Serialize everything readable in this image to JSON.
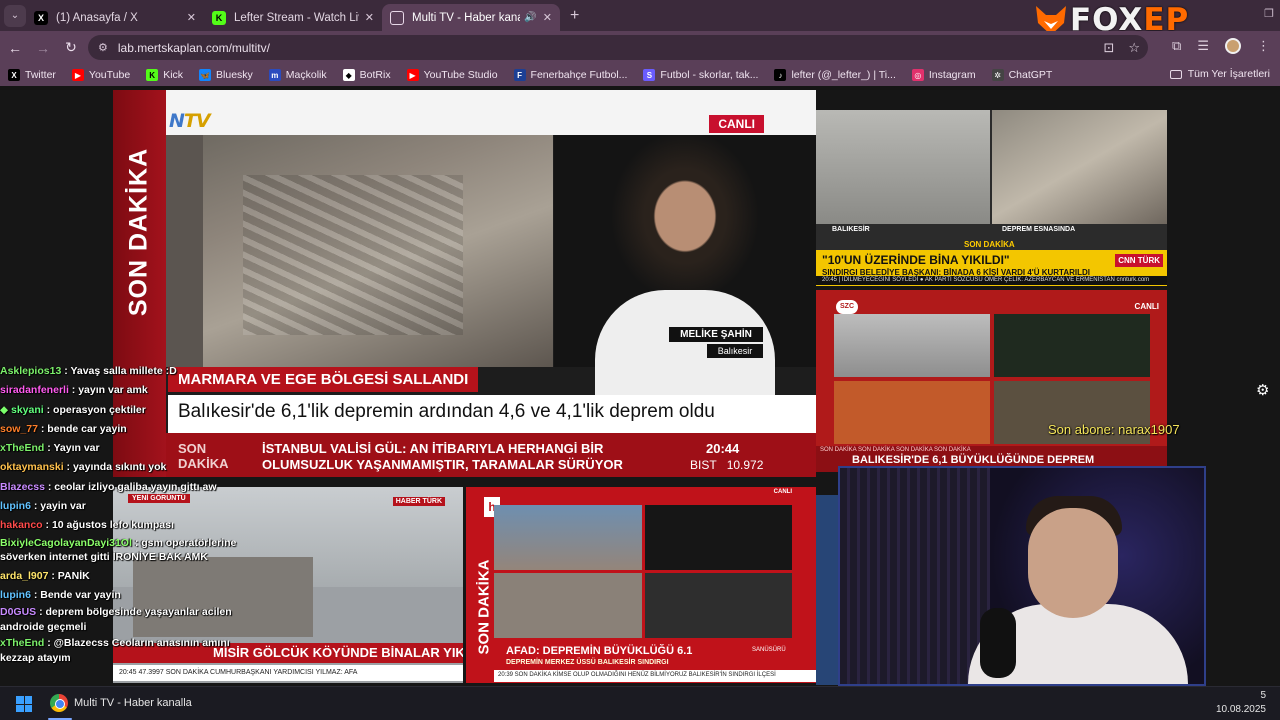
{
  "browser": {
    "tabs": [
      {
        "title": "(1) Anasayfa / X",
        "icon": "x-logo-icon",
        "active": false
      },
      {
        "title": "Lefter Stream - Watch Live on K",
        "icon": "kick-logo-icon",
        "active": false
      },
      {
        "title": "Multi TV - Haber kanalları",
        "icon": "tv-icon",
        "active": true
      }
    ],
    "url": "lab.mertskaplan.com/multitv/",
    "bookmarks": [
      {
        "label": "Twitter",
        "color": "#000000",
        "glyph": "X"
      },
      {
        "label": "YouTube",
        "color": "#ff0000",
        "glyph": "▶"
      },
      {
        "label": "Kick",
        "color": "#53fc18",
        "glyph": "K"
      },
      {
        "label": "Bluesky",
        "color": "#1185fe",
        "glyph": "🦋"
      },
      {
        "label": "Maçkolik",
        "color": "#2a4bbf",
        "glyph": "m"
      },
      {
        "label": "BotRix",
        "color": "#ffffff",
        "glyph": "◆"
      },
      {
        "label": "YouTube Studio",
        "color": "#ff0000",
        "glyph": "▶"
      },
      {
        "label": "Fenerbahçe Futbol...",
        "color": "#1c3f94",
        "glyph": "F"
      },
      {
        "label": "Futbol - skorlar, tak...",
        "color": "#6a5cff",
        "glyph": "S"
      },
      {
        "label": "lefter (@_lefter_) | Ti...",
        "color": "#000000",
        "glyph": "♪"
      },
      {
        "label": "Instagram",
        "color": "#e1306c",
        "glyph": "◎"
      },
      {
        "label": "ChatGPT",
        "color": "#444444",
        "glyph": "✲"
      }
    ],
    "all_bookmarks": "Tüm Yer İşaretleri"
  },
  "overlay": {
    "brand_main": "FOX",
    "brand_accent": "EP",
    "watermark": "Son abone: narax1907"
  },
  "ntv": {
    "logo_n": "N",
    "logo_tv": "TV",
    "live": "CANLI",
    "vertical": "SON DAKİKA",
    "reporter_name": "MELİKE ŞAHİN",
    "reporter_location": "Balıkesir",
    "headline": "MARMARA VE EGE BÖLGESİ SALLANDI",
    "subtitle": "Balıkesir'de 6,1'lik depremin ardından 4,6 ve 4,1'lik deprem oldu",
    "ticker_label_1": "SON",
    "ticker_label_2": "DAKİKA",
    "ticker_line_1": "İSTANBUL VALİSİ GÜL: AN İTİBARIYLA HERHANGİ BİR",
    "ticker_line_2": "OLUMSUZLUK YAŞANMAMIŞTIR, TARAMALAR SÜRÜYOR",
    "clock": "20:44",
    "bist_label": "BIST",
    "bist_value": "10.972"
  },
  "cnn": {
    "caption_left": "BALIKESİR",
    "caption_right": "DEPREM ESNASINDA",
    "tag": "SON DAKİKA",
    "headline": "\"10'UN ÜZERİNDE BİNA YIKILDI\"",
    "subline": "SINDIRGI BELEDİYE BAŞKANI: BİNADA 6 KİŞİ VARDI 4'Ü KURTARILDI",
    "logo": "CNN TÜRK",
    "strip": "20:45 | İDILMEYECEĞİNİ SÖYLEDİ   ● AK PARTİ SÖZCÜSÜ ÖMER ÇELİK: AZERBAYCAN VE ERMENİSTAN   cnnturk.com"
  },
  "szc": {
    "logo": "SZC",
    "live": "CANLI",
    "band_top": "SON DAKİKA   SON DAKİKA   SON DAKİKA   SON DAKİKA",
    "headline": "BALIKESİR'DE 6,1 BÜYÜKLÜĞÜNDE DEPREM"
  },
  "haberturk": {
    "tag": "YENİ GÖRÜNTÜ",
    "logo": "HABER TÜRK",
    "vertical_badge": "SON DAKİKA",
    "headline": "MİSİR GÖLCÜK KÖYÜNDE BİNALAR YIKILDI",
    "strip": "20:45  47.3997   SON DAKİKA   CUMHURBAŞKANI YARDIMCISI YILMAZ: AFA"
  },
  "haber": {
    "logo": "h",
    "live": "CANLI",
    "vertical": "SON DAKİKA",
    "headline": "AFAD: DEPREMİN BÜYÜKLÜĞÜ 6.1",
    "subline": "DEPREMİN MERKEZ ÜSSÜ BALIKESİR SINDIRGI",
    "tag": "SANÜSÜRÜ",
    "strip": "20:39  SON DAKİKA  KİMSE OLUP OLMADIĞINI HENÜZ BİLMİYORUZ   BALIKESİR'İN SINDIRGI İLÇESİ"
  },
  "chat": [
    {
      "user": "Asklepios13",
      "color": "#7cf06b",
      "text": ": Yavaş salla millete :D",
      "wrap": false
    },
    {
      "user": "siradanfenerli",
      "color": "#ff5cf0",
      "text": ": yayın var amk",
      "wrap": false
    },
    {
      "user": "skyani",
      "color": "#62ff7e",
      "text": ": operasyon çektiler",
      "wrap": false,
      "badge": "◆"
    },
    {
      "user": "sow_77",
      "color": "#ff7f2a",
      "text": ": bende car yayin",
      "wrap": false
    },
    {
      "user": "xTheEnd",
      "color": "#7cf06b",
      "text": ": Yayın var",
      "wrap": false
    },
    {
      "user": "oktaymanski",
      "color": "#ffc14d",
      "text": ": yayında sıkıntı yok",
      "wrap": false
    },
    {
      "user": "Blazecss",
      "color": "#c88bff",
      "text": ": ceolar izliyo galiba yayın gittı aw",
      "wrap": false
    },
    {
      "user": "lupin6",
      "color": "#62c3ff",
      "text": ": yayin var",
      "wrap": false
    },
    {
      "user": "hakanco",
      "color": "#ff4b4b",
      "text": ": 10 ağustos lefo kumpası",
      "wrap": false
    },
    {
      "user": "BixiyleCagolayanDayi31Ol",
      "color": "#8cff6b",
      "text": ": gsm operatörlerine söverken internet gitti İRONİYE BAK AMK",
      "wrap": true
    },
    {
      "user": "arda_l907",
      "color": "#ffe56b",
      "text": ": PANİK",
      "wrap": false
    },
    {
      "user": "lupin6",
      "color": "#62c3ff",
      "text": ": Bende var yayin",
      "wrap": false
    },
    {
      "user": "D0GUS",
      "color": "#c88bff",
      "text": ": deprem bölgesinde yaşayanlar acilen androide geçmeli",
      "wrap": true
    },
    {
      "user": "xTheEnd",
      "color": "#7cf06b",
      "text": ": @Blazecss Ceoların anasının amını kezzap atayım",
      "wrap": true
    }
  ],
  "taskbar": {
    "app_title": "Multi TV - Haber kanalla",
    "time": "5",
    "date": "10.08.2025"
  }
}
